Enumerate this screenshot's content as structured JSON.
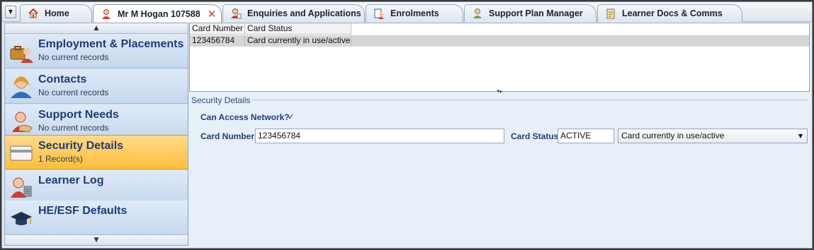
{
  "tabs": [
    {
      "label": "Home",
      "icon": "home-icon"
    },
    {
      "label": "Mr M Hogan 107588",
      "icon": "person-icon",
      "active": true,
      "closable": true
    },
    {
      "label": "Enquiries and Applications",
      "icon": "person-enquiry-icon"
    },
    {
      "label": "Enrolments",
      "icon": "enrolments-icon"
    },
    {
      "label": "Support Plan Manager",
      "icon": "support-plan-icon"
    },
    {
      "label": "Learner Docs & Comms",
      "icon": "documents-icon"
    }
  ],
  "sidebar": {
    "items": [
      {
        "title": "Employment & Placements",
        "subtitle": "No current records",
        "icon": "briefcase-person-icon"
      },
      {
        "title": "Contacts",
        "subtitle": "No current records",
        "icon": "contacts-icon"
      },
      {
        "title": "Support Needs",
        "subtitle": "No current records",
        "icon": "support-hand-icon"
      },
      {
        "title": "Security Details",
        "subtitle": "1 Record(s)",
        "icon": "card-icon",
        "selected": true
      },
      {
        "title": "Learner Log",
        "subtitle": "",
        "icon": "learner-log-icon"
      },
      {
        "title": "HE/ESF Defaults",
        "subtitle": "",
        "icon": "graduation-cap-icon"
      }
    ]
  },
  "grid": {
    "columns": [
      "Card Number",
      "Card Status"
    ],
    "rows": [
      [
        "123456784",
        "Card currently in use/active"
      ]
    ]
  },
  "details": {
    "group_title": "Security Details",
    "can_access_label": "Can Access Network?",
    "can_access_checked": true,
    "check_glyph": "✓",
    "card_number_label": "Card Number",
    "card_number_value": "123456784",
    "card_status_label": "Card Status",
    "card_status_code": "ACTIVE",
    "card_status_description": "Card currently in use/active"
  },
  "colors": {
    "selected_item": "#ffbf3a",
    "label_blue": "#223f78",
    "close_red": "#d4372b"
  }
}
